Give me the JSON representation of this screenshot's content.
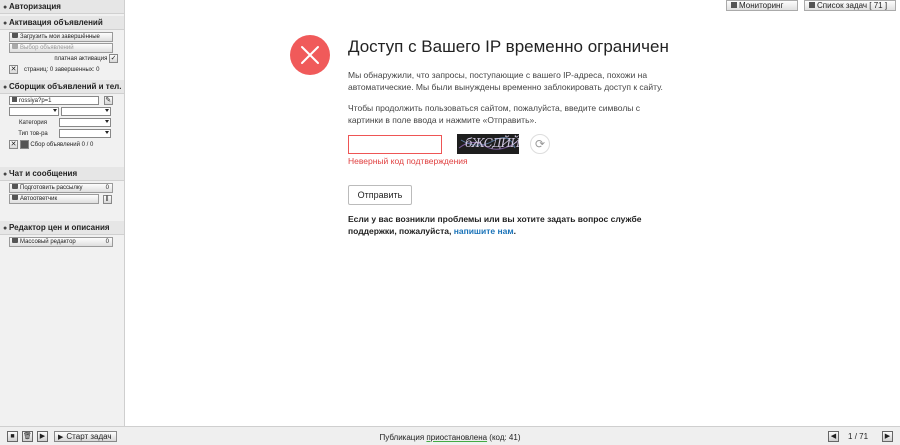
{
  "sidebar": {
    "sections": [
      {
        "label": "Авторизация"
      },
      {
        "label": "Активация объявлений"
      },
      {
        "label": "Сборщик объявлений и тел."
      },
      {
        "label": "Чат и сообщения"
      },
      {
        "label": "Редактор цен и описания"
      }
    ],
    "activation": {
      "load_button": "Загрузить мои завершённые",
      "select_button": "Выбор объявлений",
      "paid_label": "платная активация",
      "paid_checked": true,
      "pages_label": "страниц: 0 завершенных: 0"
    },
    "collector": {
      "url_value": "rossiya?p=1",
      "category_label": "Категория",
      "type_label": "Тип тов-ра",
      "collect_button": "Сбор объявлений",
      "collect_count": "0 / 0"
    },
    "chat": {
      "prepare_button": "Подготовить рассылку",
      "prepare_count": "0",
      "autoreply_button": "Автоответчик"
    },
    "editor": {
      "mass_button": "Массовый редактор",
      "mass_count": "0"
    }
  },
  "topbar": {
    "monitoring_label": "Мониторинг",
    "tasks_label": "Список задач [ 71 ]"
  },
  "main": {
    "title": "Доступ с Вашего IP временно ограничен",
    "para1": "Мы обнаружили, что запросы, поступающие с вашего IP-адреса, похожи на автоматические. Мы были вынуждены временно заблокировать доступ к сайту.",
    "para2": "Чтобы продолжить пользоваться сайтом, пожалуйста, введите символы с картинки в поле ввода и нажмите «Отправить».",
    "captcha_text": "бЖСДЙЙ",
    "error_text": "Неверный код подтверждения",
    "submit_label": "Отправить",
    "help_text": "Если у вас возникли проблемы или вы хотите задать вопрос службе поддержки, пожалуйста, ",
    "help_link": "напишите нам",
    "help_end": "."
  },
  "bottombar": {
    "start_label": "Старт задач",
    "status_prefix": "Публикация ",
    "status_word": "приостановлена",
    "status_suffix": " (код: 41)",
    "page_current": "1",
    "page_sep": "/",
    "page_total": "71"
  },
  "colors": {
    "error_red": "#f05a5a",
    "link_blue": "#1a73b8"
  }
}
